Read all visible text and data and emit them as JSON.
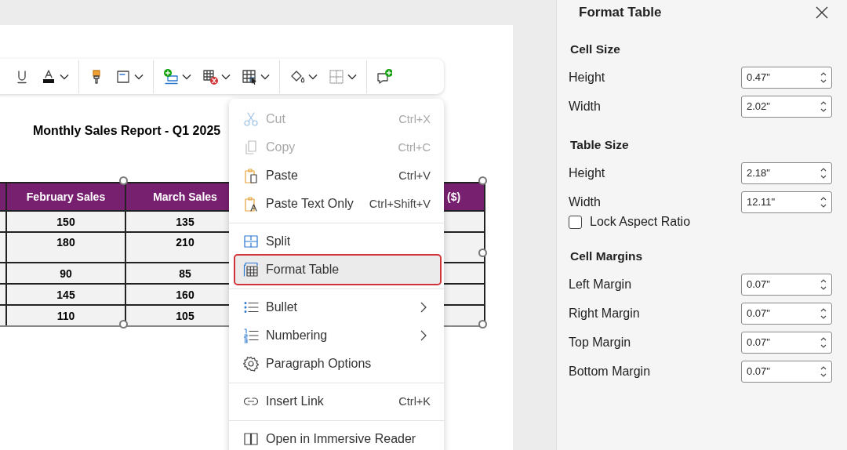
{
  "document": {
    "heading": "Monthly Sales Report - Q1 2025",
    "table": {
      "columns": [
        "February Sales",
        "March Sales",
        "($)"
      ],
      "rows": [
        [
          "150",
          "135"
        ],
        [
          "180",
          "210"
        ],
        [
          "90",
          "85"
        ],
        [
          "145",
          "160"
        ],
        [
          "110",
          "105"
        ]
      ]
    }
  },
  "context_menu": {
    "items": [
      {
        "kind": "item",
        "label": "Cut",
        "shortcut": "Ctrl+X",
        "disabled": true,
        "selected": false,
        "submenu": false
      },
      {
        "kind": "item",
        "label": "Copy",
        "shortcut": "Ctrl+C",
        "disabled": true,
        "selected": false,
        "submenu": false
      },
      {
        "kind": "item",
        "label": "Paste",
        "shortcut": "Ctrl+V",
        "disabled": false,
        "selected": false,
        "submenu": false
      },
      {
        "kind": "item",
        "label": "Paste Text Only",
        "shortcut": "Ctrl+Shift+V",
        "disabled": false,
        "selected": false,
        "submenu": false
      },
      {
        "kind": "divider"
      },
      {
        "kind": "item",
        "label": "Split",
        "disabled": false,
        "selected": false,
        "submenu": false
      },
      {
        "kind": "item",
        "label": "Format Table",
        "disabled": false,
        "selected": true,
        "submenu": false
      },
      {
        "kind": "divider"
      },
      {
        "kind": "item",
        "label": "Bullet",
        "disabled": false,
        "selected": false,
        "submenu": true
      },
      {
        "kind": "item",
        "label": "Numbering",
        "disabled": false,
        "selected": false,
        "submenu": true
      },
      {
        "kind": "item",
        "label": "Paragraph Options",
        "disabled": false,
        "selected": false,
        "submenu": false
      },
      {
        "kind": "divider"
      },
      {
        "kind": "item",
        "label": "Insert Link",
        "shortcut": "Ctrl+K",
        "disabled": false,
        "selected": false,
        "submenu": false
      },
      {
        "kind": "divider"
      },
      {
        "kind": "item",
        "label": "Open in Immersive Reader",
        "disabled": false,
        "selected": false,
        "submenu": false
      }
    ]
  },
  "panel": {
    "title": "Format Table",
    "sections": [
      {
        "heading": "Cell Size",
        "fields": [
          {
            "label": "Height",
            "value": "0.47\""
          },
          {
            "label": "Width",
            "value": "2.02\""
          }
        ]
      },
      {
        "heading": "Table Size",
        "fields": [
          {
            "label": "Height",
            "value": "2.18\""
          },
          {
            "label": "Width",
            "value": "12.11\""
          }
        ],
        "options": [
          {
            "label": "Lock Aspect Ratio",
            "checked": false
          }
        ]
      },
      {
        "heading": "Cell Margins",
        "fields": [
          {
            "label": "Left Margin",
            "value": "0.07\""
          },
          {
            "label": "Right Margin",
            "value": "0.07\""
          },
          {
            "label": "Top Margin",
            "value": "0.07\""
          },
          {
            "label": "Bottom Margin",
            "value": "0.07\""
          }
        ]
      }
    ]
  }
}
